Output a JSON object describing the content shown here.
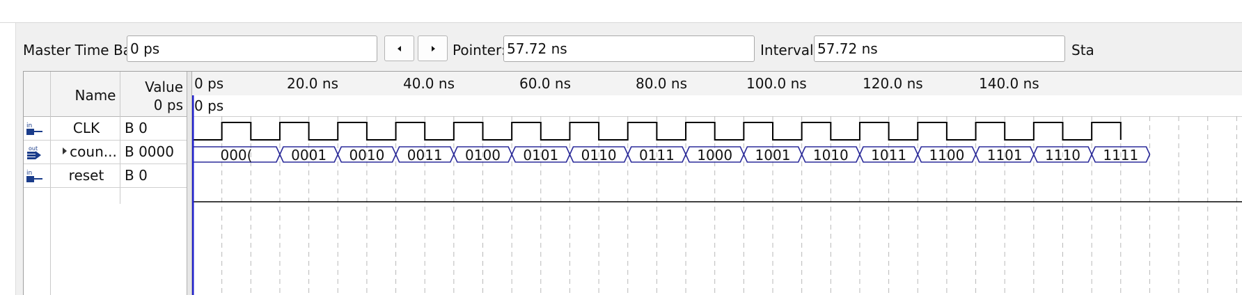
{
  "toolbar": {
    "master_time_bar_label": "Master Time Bar:",
    "master_time_bar_value": "0 ps",
    "prev_icon": "triangle-left-icon",
    "next_icon": "triangle-right-icon",
    "pointer_label": "Pointer:",
    "pointer_value": "57.72 ns",
    "interval_label": "Interval:",
    "interval_value": "57.72 ns",
    "truncated_label": "Sta"
  },
  "signal_table": {
    "name_header": "Name",
    "value_header": "Value",
    "value_time": "0 ps",
    "signals": [
      {
        "icon": "input-pin-icon",
        "name": "CLK",
        "value": "B 0"
      },
      {
        "icon": "output-pin-icon",
        "name": "coun...",
        "value": "B 0000",
        "expandable": true
      },
      {
        "icon": "input-pin-icon",
        "name": "reset",
        "value": "B 0"
      }
    ]
  },
  "timeline": {
    "tick_labels": [
      "0 ps",
      "20.0 ns",
      "40.0 ns",
      "60.0 ns",
      "80.0 ns",
      "100.0 ns",
      "120.0 ns",
      "140.0 ns"
    ],
    "pointer_label": "0 ps",
    "counter_segments": [
      "000(",
      "0001",
      "0010",
      "0011",
      "0100",
      "0101",
      "0110",
      "0111",
      "1000",
      "1001",
      "1010",
      "1011",
      "1100",
      "1101",
      "1110",
      "1111"
    ]
  },
  "colors": {
    "wave_black": "#000000",
    "bus_blue": "#2a2a9a",
    "cursor_blue": "#2222cc",
    "grid_dash": "#b8b8b8"
  }
}
